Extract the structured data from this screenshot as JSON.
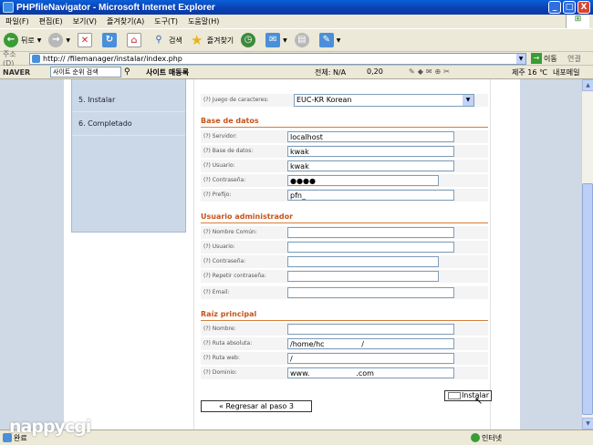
{
  "window": {
    "title": "PHPfileNavigator - Microsoft Internet Explorer",
    "min": "_",
    "max": "□",
    "close": "X"
  },
  "menu": [
    "파일(F)",
    "편집(E)",
    "보기(V)",
    "즐겨찾기(A)",
    "도구(T)",
    "도움말(H)"
  ],
  "toolbar": {
    "back": "뒤로",
    "search": "검색",
    "favorites": "즐겨찾기"
  },
  "address": {
    "label": "주소(D)",
    "url": "http://                          /filemanager/instalar/index.php",
    "go": "이동",
    "links": "연결"
  },
  "naver": {
    "logo": "NAVER",
    "search_placeholder": "사이트 순위 검색",
    "hot": "사이트 매동록",
    "total": "전체: N/A",
    "index": "0,20",
    "weather": "제주 16 ℃",
    "mail": "내포메일"
  },
  "sidebar": {
    "items": [
      "5.  Instalar",
      "6.  Completado"
    ]
  },
  "form": {
    "charset_label": "(?) Juego de caracteres:",
    "charset_value": "EUC-KR Korean",
    "db_title": "Base de datos",
    "db_fields": [
      {
        "label": "(?) Servidor:",
        "value": "localhost"
      },
      {
        "label": "(?) Base de datos:",
        "value": "kwak"
      },
      {
        "label": "(?) Usuario:",
        "value": "kwak"
      },
      {
        "label": "(?) Contraseña:",
        "value": "●●●●"
      },
      {
        "label": "(?) Prefijo:",
        "value": "pfn_"
      }
    ],
    "admin_title": "Usuario administrador",
    "admin_fields": [
      {
        "label": "(?) Nombre Común:",
        "value": ""
      },
      {
        "label": "(?) Usuario:",
        "value": ""
      },
      {
        "label": "(?) Contraseña:",
        "value": ""
      },
      {
        "label": "(?) Repetir contraseña:",
        "value": ""
      },
      {
        "label": "(?) Email:",
        "value": ""
      }
    ],
    "root_title": "Raíz principal",
    "root_fields": [
      {
        "label": "(?) Nombre:",
        "value": ""
      },
      {
        "label": "(?) Ruta absoluta:",
        "value": "/home/hc                /"
      },
      {
        "label": "(?) Ruta web:",
        "value": "/"
      },
      {
        "label": "(?) Dominio:",
        "value": "www.                    .com"
      }
    ],
    "install_button": "Instalar",
    "back_button": "« Regresar al paso 3"
  },
  "status": {
    "left": "완료",
    "zone": "인터넷"
  },
  "watermark": "nappycgi"
}
